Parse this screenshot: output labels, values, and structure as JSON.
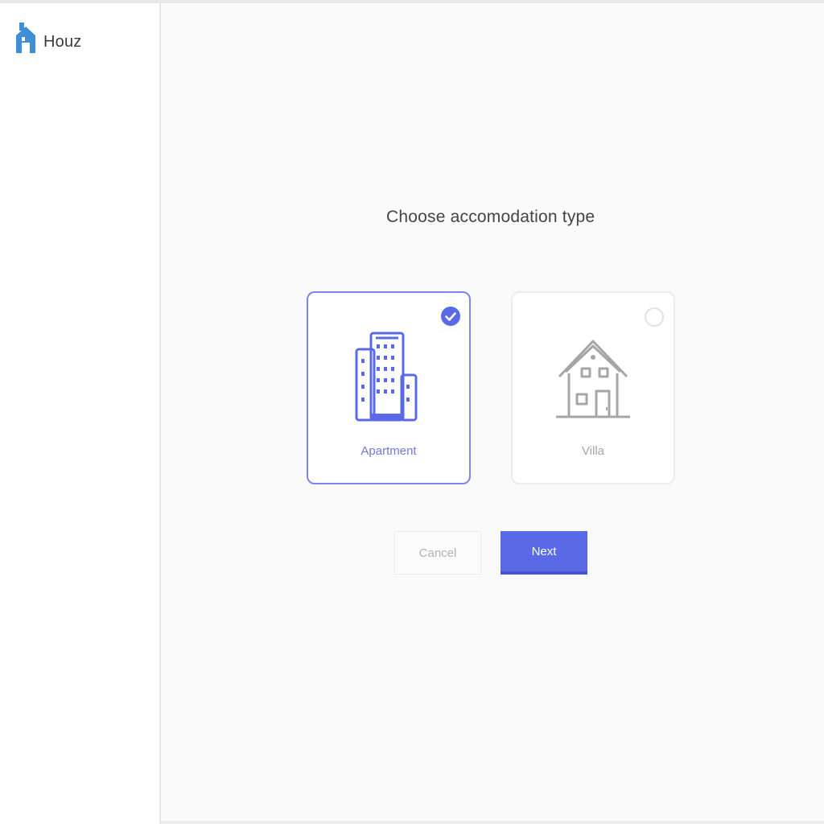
{
  "brand": {
    "name": "Houz",
    "logo_icon": "house-logo-icon",
    "logo_color": "#3f8fd6"
  },
  "main": {
    "title": "Choose accomodation type",
    "options": [
      {
        "label": "Apartment",
        "icon": "apartment-building-icon",
        "selected": true
      },
      {
        "label": "Villa",
        "icon": "house-icon",
        "selected": false
      }
    ],
    "buttons": {
      "cancel_label": "Cancel",
      "next_label": "Next"
    }
  },
  "colors": {
    "accent": "#5a6ae6",
    "selected_border": "#7b86e8",
    "unselected_icon": "#a6a6a6"
  }
}
